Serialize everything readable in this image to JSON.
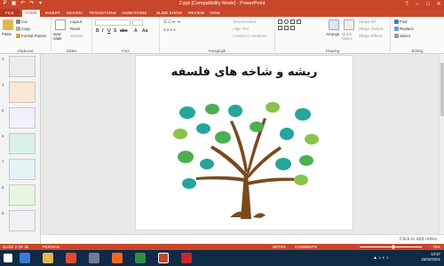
{
  "window": {
    "title": "2.ppt [Compatibility Mode] - PowerPoint",
    "controls": [
      "?",
      "–",
      "□",
      "✕"
    ]
  },
  "tabs": [
    "FILE",
    "HOME",
    "INSERT",
    "DESIGN",
    "TRANSITIONS",
    "ANIMATIONS",
    "SLIDE SHOW",
    "REVIEW",
    "VIEW"
  ],
  "ribbon": {
    "clipboard": {
      "paste": "Paste",
      "cut": "Cut",
      "copy": "Copy",
      "format_painter": "Format Painter",
      "label": "Clipboard"
    },
    "slides": {
      "new_slide": "New Slide",
      "layout": "Layout",
      "reset": "Reset",
      "section": "Section",
      "label": "Slides"
    },
    "font": {
      "label": "Font"
    },
    "paragraph": {
      "text_direction": "Text Direction",
      "align_text": "Align Text",
      "convert_smartart": "Convert to SmartArt",
      "label": "Paragraph"
    },
    "drawing": {
      "arrange": "Arrange",
      "quick_styles": "Quick Styles",
      "shape_fill": "Shape Fill",
      "shape_outline": "Shape Outline",
      "shape_effects": "Shape Effects",
      "label": "Drawing"
    },
    "editing": {
      "find": "Find",
      "replace": "Replace",
      "select": "Select",
      "label": "Editing"
    }
  },
  "thumbnails": [
    "3",
    "4",
    "5",
    "6",
    "7",
    "8",
    "9"
  ],
  "slide": {
    "title": "ریشه و شاخه های فلسفه"
  },
  "notes_placeholder": "Click to add notes",
  "status": {
    "slide_info": "SLIDE 2 OF 25",
    "language": "PERSIAN",
    "notes": "NOTES",
    "comments": "COMMENTS",
    "zoom": "78%",
    "zoom_level": 0.55
  },
  "taskbar": {
    "time": "12:57",
    "date": "25/02/2021"
  },
  "colors": {
    "accent": "#c8472b",
    "leaf_light": "#8bc34a",
    "leaf_green": "#4caf50",
    "leaf_teal": "#26a69a",
    "trunk": "#7a4a1e"
  }
}
